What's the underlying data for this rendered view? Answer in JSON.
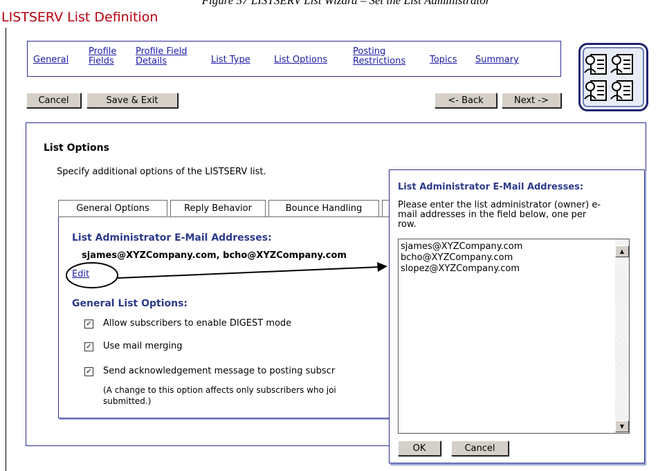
{
  "caption": "Figure 57 LISTSERV List Wizard – Set the List Administrator",
  "app_title": "LISTSERV List Definition",
  "nav": {
    "general": "General",
    "profile_fields_1": "Profile",
    "profile_fields_2": "Fields",
    "profile_field_details_1": "Profile Field",
    "profile_field_details_2": "Details",
    "list_type": "List Type",
    "list_options": "List Options",
    "posting_restrictions_1": "Posting",
    "posting_restrictions_2": "Restrictions",
    "topics": "Topics",
    "summary": "Summary"
  },
  "toolbar": {
    "cancel": "Cancel",
    "save_exit": "Save & Exit",
    "back": "<- Back",
    "next": "Next ->"
  },
  "main": {
    "title": "List Options",
    "description": "Specify additional options of the LISTSERV list.",
    "tabs": [
      "General Options",
      "Reply Behavior",
      "Bounce Handling"
    ],
    "admin_heading": "List Administrator E-Mail Addresses:",
    "admin_emails": "sjames@XYZCompany.com, bcho@XYZCompany.com",
    "edit_link": "Edit",
    "general_heading": "General List Options:",
    "options": [
      {
        "label": "Allow subscribers to enable DIGEST mode",
        "checked": true
      },
      {
        "label": "Use mail merging",
        "checked": true
      },
      {
        "label": "Send acknowledgement message to posting subscr",
        "checked": true
      }
    ],
    "note_line1": "(A change to this option affects only subscribers who joi",
    "note_line2": "submitted.)"
  },
  "popup": {
    "title": "List Administrator E-Mail Addresses:",
    "instr_1": "Please enter the list administrator (owner) e-",
    "instr_2": "mail addresses in the field below, one per",
    "instr_3": "row.",
    "addresses": [
      "sjames@XYZCompany.com",
      "bcho@XYZCompany.com",
      "slopez@XYZCompany.com"
    ],
    "ok": "OK",
    "cancel": "Cancel"
  },
  "icons": {
    "wizard": "list-wizard-icon",
    "check": "checkmark-icon"
  }
}
